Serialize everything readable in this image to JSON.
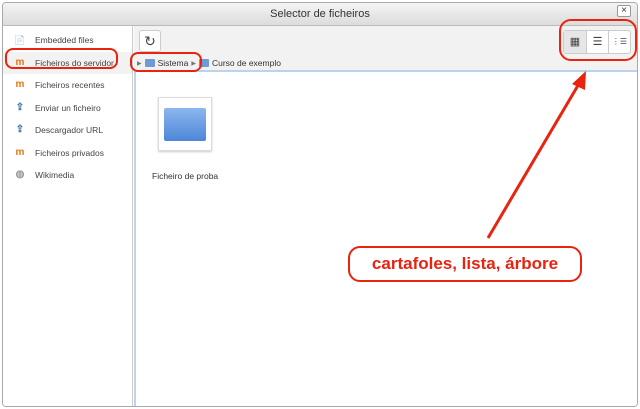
{
  "window": {
    "title": "Selector de ficheiros",
    "close": "×"
  },
  "sidebar": {
    "items": [
      {
        "label": "Embedded files",
        "icon": "file-icon",
        "glyph": "📄"
      },
      {
        "label": "Ficheiros do servidor",
        "icon": "moodle-icon",
        "glyph": "m"
      },
      {
        "label": "Ficheiros recentes",
        "icon": "moodle-icon",
        "glyph": "m"
      },
      {
        "label": "Enviar un ficheiro",
        "icon": "upload-icon",
        "glyph": "⇪"
      },
      {
        "label": "Descargador URL",
        "icon": "download-icon",
        "glyph": "⇪"
      },
      {
        "label": "Ficheiros privados",
        "icon": "moodle-icon",
        "glyph": "m"
      },
      {
        "label": "Wikimedia",
        "icon": "wikimedia-icon",
        "glyph": "◍"
      }
    ]
  },
  "toolbar": {
    "refresh": "↻",
    "views": [
      "▦",
      "☰",
      "⋮☰"
    ]
  },
  "breadcrumb": [
    "Sistema",
    "Curso de exemplo"
  ],
  "files": [
    {
      "name": "Ficheiro de proba"
    }
  ],
  "annotation": {
    "text": "cartafoles, lista, árbore",
    "color": "#e8230f"
  }
}
